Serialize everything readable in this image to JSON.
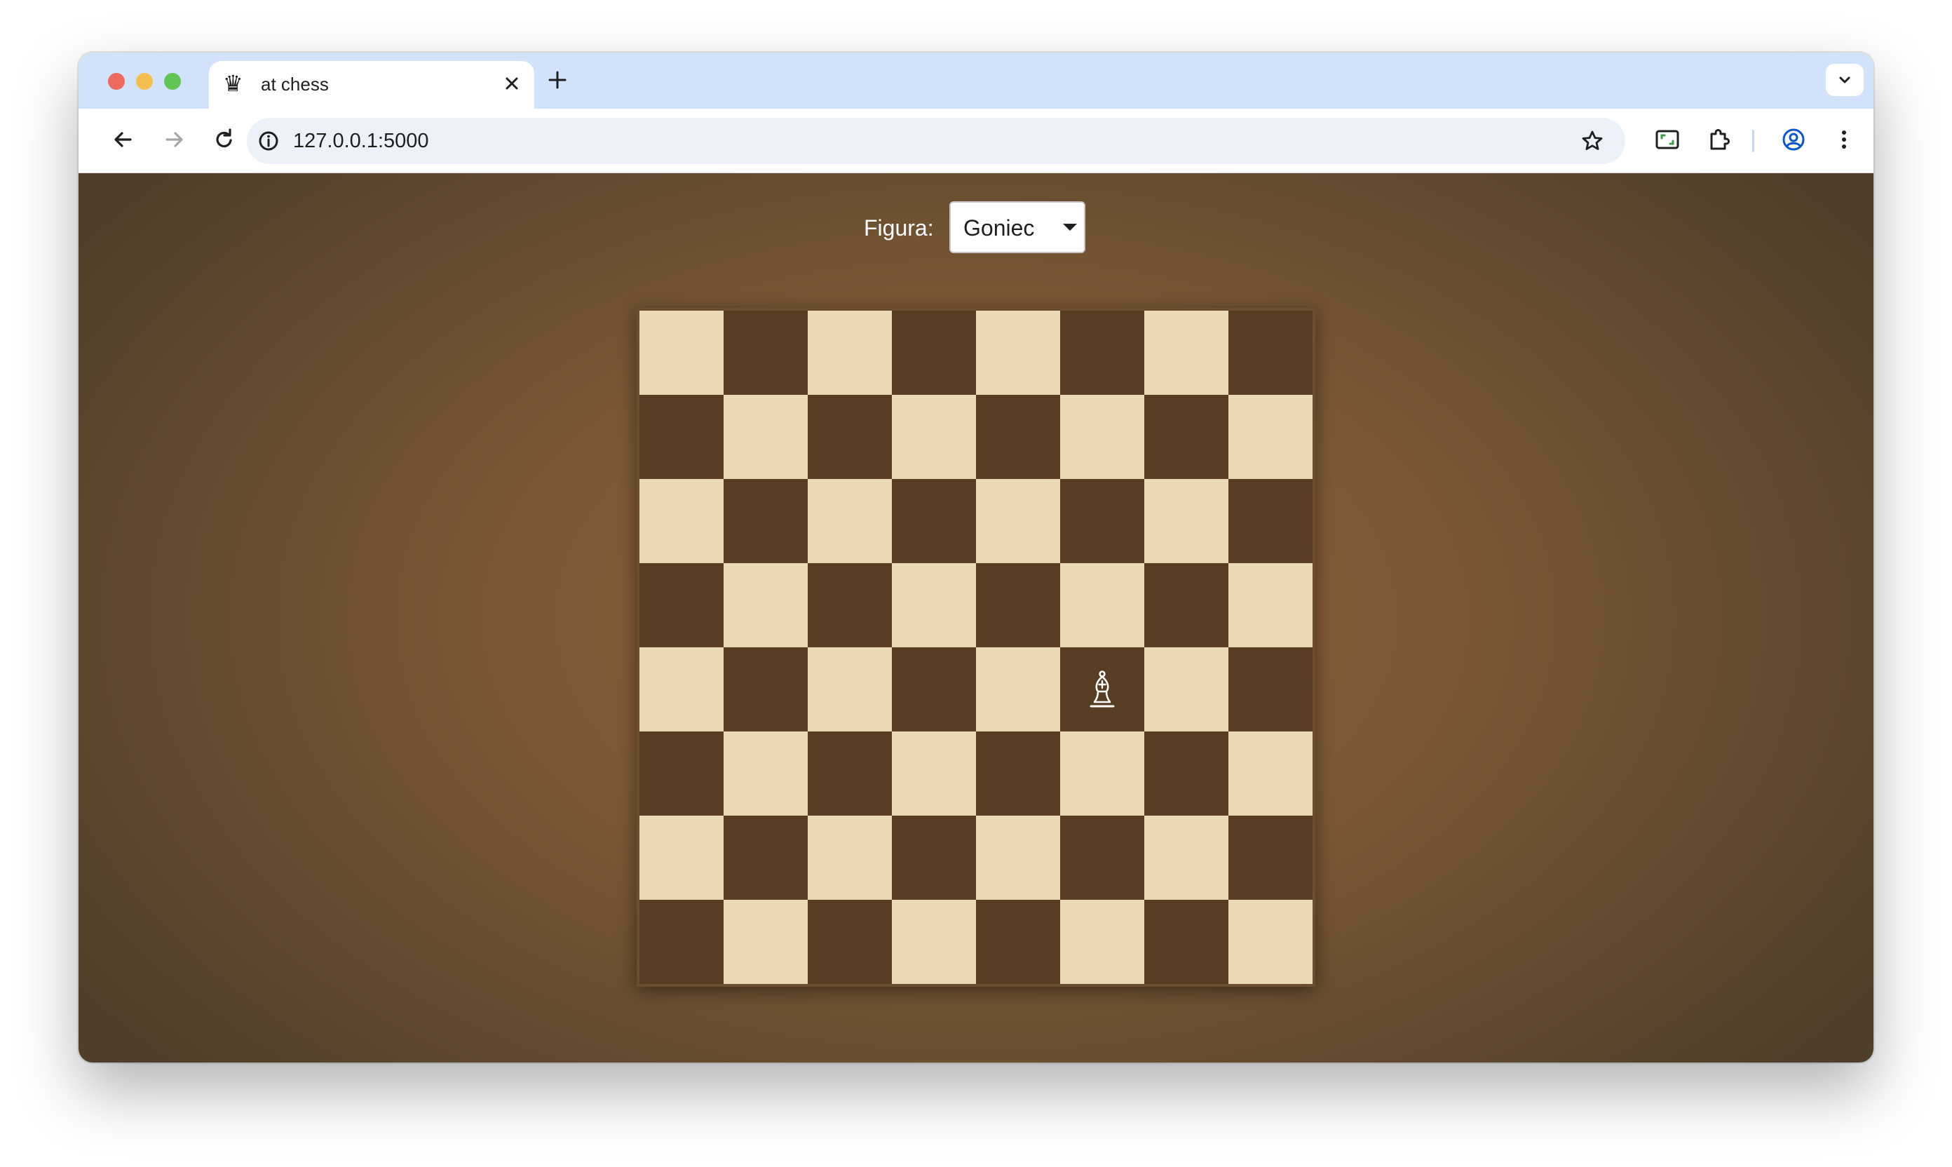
{
  "browser": {
    "tab": {
      "title": "at chess",
      "favicon": "chess-queen-icon"
    },
    "url": "127.0.0.1:5000",
    "icons": {
      "back": "arrow-left-icon",
      "forward": "arrow-right-icon",
      "reload": "reload-icon",
      "site_info": "info-icon",
      "bookmark": "star-icon",
      "screenshot": "screen-capture-icon",
      "extensions": "puzzle-icon",
      "profile": "profile-icon",
      "menu": "kebab-menu-icon",
      "tab_list": "chevron-down-icon",
      "new_tab": "plus-icon",
      "close_tab": "close-icon"
    }
  },
  "controls": {
    "piece_label": "Figura:",
    "piece_select": {
      "selected": "Goniec"
    }
  },
  "board": {
    "rows": 8,
    "cols": 8,
    "top_left_color": "light",
    "colors": {
      "light": "#ebd9b5",
      "dark": "#583d22"
    },
    "pieces": [
      {
        "type": "bishop",
        "color": "white",
        "row": 4,
        "col": 5
      }
    ]
  },
  "colors": {
    "tabbar": "#d3e2fb",
    "omnibox": "#edf2fa",
    "page_center": "#8c6239",
    "page_edge": "#4f3f2a"
  }
}
